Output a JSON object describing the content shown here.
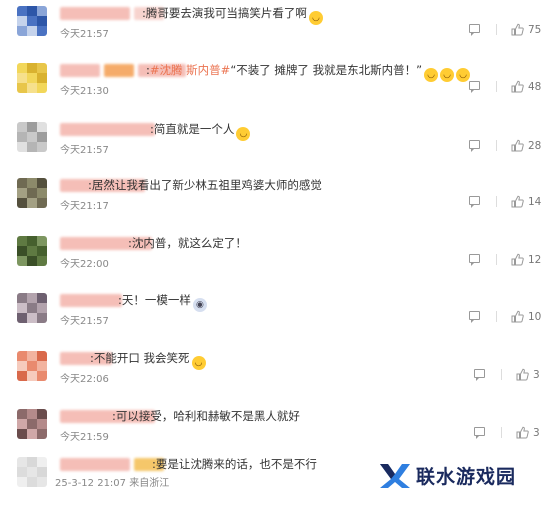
{
  "comments": [
    {
      "text_prefix": ":",
      "hashtag": "",
      "text": "腾哥要去演我可当搞笑片看了啊",
      "text_suffix": "",
      "emojis": [
        "laugh"
      ],
      "time": "今天21:57",
      "likes": "75",
      "avatar_colors": [
        "#4a72c2",
        "#2d56a8",
        "#8aa5d8",
        "#c5d3ec"
      ],
      "name_colors": [
        "#f4b8b0",
        "#f7cfc9"
      ]
    },
    {
      "text_prefix": ":",
      "hashtag": "#沈腾 斯内普#",
      "text": "“不装了 摊牌了 我就是东北斯内普！”",
      "text_suffix": "",
      "emojis": [
        "laugh-cry",
        "laugh-cry",
        "laugh-cry"
      ],
      "time": "今天21:30",
      "likes": "48",
      "avatar_colors": [
        "#f2d75a",
        "#d9b22f",
        "#e8c64a",
        "#f6e08c"
      ],
      "name_colors": [
        "#f4b8b0",
        "#f5a35a"
      ]
    },
    {
      "text_prefix": ":",
      "hashtag": "",
      "text": "简直就是一个人",
      "text_suffix": "",
      "emojis": [
        "awkward"
      ],
      "time": "今天21:57",
      "likes": "28",
      "avatar_colors": [
        "#c9c9c9",
        "#9d9d9d",
        "#e0e0e0",
        "#b5b5b5"
      ],
      "name_colors": [
        "#f4b8b0",
        "#f7cfc9"
      ]
    },
    {
      "text_prefix": ":",
      "hashtag": "",
      "text": "居然让我看出了新少林五祖里鸡婆大师的感觉",
      "text_suffix": "",
      "emojis": [],
      "time": "今天21:17",
      "likes": "14",
      "avatar_colors": [
        "#6f6a52",
        "#8c8a6a",
        "#54503d",
        "#a3a083"
      ],
      "name_colors": [
        "#f4b8b0",
        "#f7cfc9"
      ]
    },
    {
      "text_prefix": ":",
      "hashtag": "",
      "text": "沈内普，就这么定了！",
      "text_suffix": "",
      "emojis": [],
      "time": "今天22:00",
      "likes": "12",
      "avatar_colors": [
        "#5f7a42",
        "#46602e",
        "#7d9660",
        "#3a4f27"
      ],
      "name_colors": [
        "#f4b8b0",
        "#f7cfc9"
      ]
    },
    {
      "text_prefix": ":",
      "hashtag": "",
      "text": "天！一模一样",
      "text_suffix": "",
      "emojis": [
        "shock"
      ],
      "time": "今天21:57",
      "likes": "10",
      "avatar_colors": [
        "#8a7b86",
        "#b3a3ad",
        "#6e6070",
        "#cbbdc6"
      ],
      "name_colors": [
        "#f4b8b0",
        "#f7cfc9"
      ]
    },
    {
      "text_prefix": ":",
      "hashtag": "",
      "text": "不能开口 我会笑死",
      "text_suffix": "",
      "emojis": [
        "laugh"
      ],
      "time": "今天22:06",
      "likes": "3",
      "avatar_colors": [
        "#e98a6e",
        "#f2b39f",
        "#d9694b",
        "#f6cbbd"
      ],
      "name_colors": [
        "#f4b8b0",
        "#f7cfc9"
      ]
    },
    {
      "text_prefix": ":",
      "hashtag": "",
      "text": "可以接受，哈利和赫敏不是黑人就好",
      "text_suffix": "",
      "emojis": [],
      "time": "今天21:59",
      "likes": "3",
      "avatar_colors": [
        "#8c6a6a",
        "#b48a8a",
        "#6a4c4c",
        "#d0a8a8"
      ],
      "name_colors": [
        "#f4b8b0",
        "#f7cfc9"
      ]
    },
    {
      "text_prefix": ":",
      "hashtag": "",
      "text": "要是让沈腾来的话，也不是不行",
      "text_suffix": "",
      "emojis": [],
      "time": "25-3-12 21:07 来自浙江",
      "likes": "",
      "avatar_colors": [
        "#e6e6e6",
        "#d8d8d8",
        "#efefef",
        "#dcdcdc"
      ],
      "name_colors": [
        "#f4b8b0",
        "#f5c15a"
      ]
    }
  ],
  "watermark": {
    "text": "联水游戏园",
    "color": "#1a2a5e",
    "accent": "#2f7fe0"
  },
  "icons": {
    "reply": "reply-icon",
    "like": "thumbs-up-icon"
  }
}
